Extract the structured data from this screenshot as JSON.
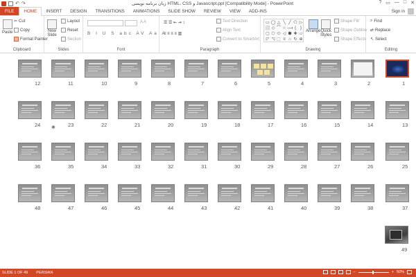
{
  "window": {
    "title": "زبان برنامه نویسی HTML، CSS و Javascript.ppt [Compatibility Mode] - PowerPoint",
    "controls": [
      "?",
      "▭",
      "—",
      "□",
      "✕"
    ]
  },
  "tabs": [
    "FILE",
    "HOME",
    "INSERT",
    "DESIGN",
    "TRANSITIONS",
    "ANIMATIONS",
    "SLIDE SHOW",
    "REVIEW",
    "VIEW",
    "ADD-INS"
  ],
  "signin": "Sign in",
  "ribbon": {
    "clipboard": {
      "label": "Clipboard",
      "paste": "Paste",
      "cut": "Cut",
      "copy": "Copy",
      "format_painter": "Format Painter"
    },
    "slides": {
      "label": "Slides",
      "new_slide": "New",
      "new_slide2": "Slide",
      "layout": "Layout",
      "reset": "Reset",
      "section": "Section"
    },
    "font": {
      "label": "Font",
      "format_row": "B I U S abc AV Aa A"
    },
    "paragraph": {
      "label": "Paragraph",
      "text_direction": "Text Direction",
      "align_text": "Align Text",
      "smartart": "Convert to SmartArt"
    },
    "drawing": {
      "label": "Drawing",
      "arrange": "Arrange",
      "quick_styles": "Quick",
      "quick_styles2": "Styles",
      "shape_fill": "Shape Fill",
      "shape_outline": "Shape Outline",
      "shape_effects": "Shape Effects",
      "shapes": [
        "▭",
        "◯",
        "△",
        "╲",
        "╱",
        "⬠",
        "▷",
        "⬜",
        "◇",
        "⌒",
        "☆",
        "⟶",
        "{",
        "}",
        "▢",
        "⬡",
        "⬭",
        "◁",
        "⬢",
        "✚",
        "▱",
        "◸",
        "◹",
        "⬚",
        "≡",
        "⌂",
        "↻",
        "⊕"
      ]
    },
    "editing": {
      "label": "Editing",
      "find": "Find",
      "replace": "Replace",
      "select": "Select"
    }
  },
  "slides": {
    "row1": [
      "12",
      "11",
      "10",
      "9",
      "8",
      "7",
      "6",
      "5",
      "4",
      "3",
      "2",
      "1"
    ],
    "row2": [
      "24",
      "23",
      "22",
      "21",
      "20",
      "19",
      "18",
      "17",
      "16",
      "15",
      "14",
      "13"
    ],
    "row3": [
      "36",
      "35",
      "34",
      "33",
      "32",
      "31",
      "30",
      "29",
      "28",
      "27",
      "26",
      "25"
    ],
    "row4": [
      "48",
      "47",
      "46",
      "45",
      "44",
      "43",
      "42",
      "41",
      "40",
      "39",
      "38",
      "37"
    ],
    "row5": [
      "49"
    ],
    "animation_marker": "✱",
    "selected": "1"
  },
  "status": {
    "slide_info": "SLIDE 1 OF 49",
    "language": "PERSIAN",
    "zoom": "50%"
  },
  "colors": {
    "accent": "#d24726",
    "ribbon_bg": "#ffffff"
  }
}
